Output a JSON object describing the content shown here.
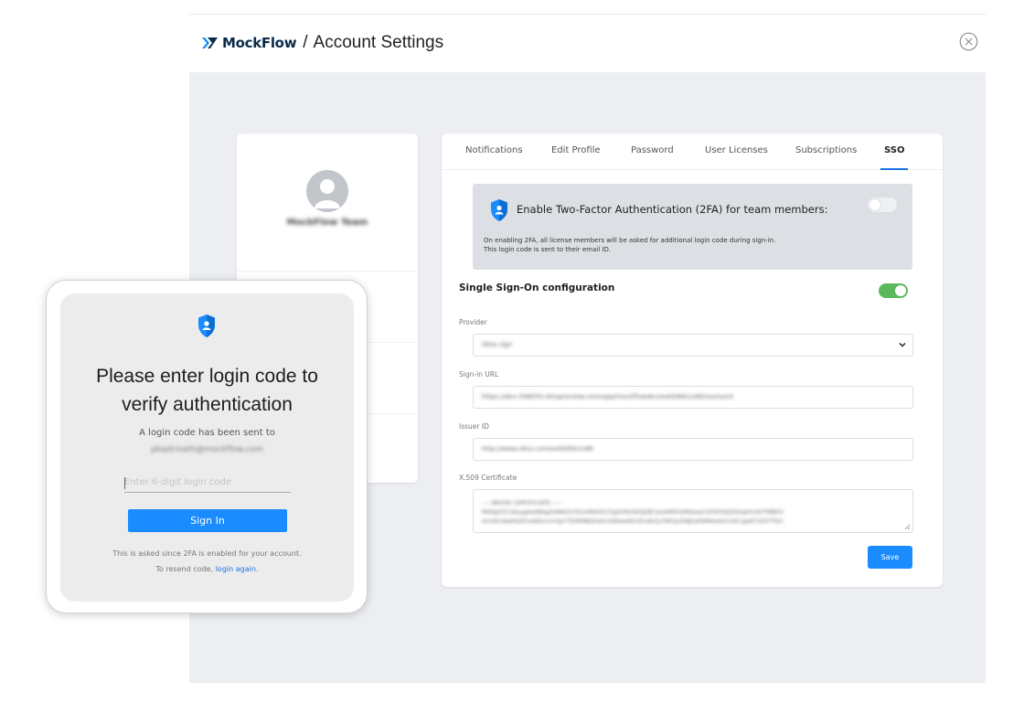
{
  "header": {
    "logo_text": "MockFlow",
    "separator": "/",
    "title": "Account Settings",
    "close_icon": "close-circle-icon"
  },
  "colors": {
    "brand_navy": "#0b2b4c",
    "accent_blue": "#1a8cff",
    "toggle_on": "#5cb85c",
    "panel_gray": "#eceef1"
  },
  "profile": {
    "avatar_icon": "user-avatar-icon",
    "name": "MockFlow Team"
  },
  "tabs": [
    {
      "label": "Notifications"
    },
    {
      "label": "Edit Profile"
    },
    {
      "label": "Password"
    },
    {
      "label": "User Licenses"
    },
    {
      "label": "Subscriptions"
    },
    {
      "label": "SSO",
      "active": true
    }
  ],
  "twofa": {
    "icon": "shield-user-icon",
    "title": "Enable Two-Factor Authentication (2FA) for team members:",
    "desc_line1": "On enabling 2FA, all license members will be asked for additional login code during sign-in.",
    "desc_line2": "This login code is sent to their email ID.",
    "enabled": false
  },
  "sso": {
    "heading": "Single Sign-On configuration",
    "enabled": true,
    "provider_label": "Provider",
    "provider_value": "Okta sign",
    "signin_url_label": "Sign-in URL",
    "signin_url_value": "https://dev-598050.oktapreview.com/app/mockflowdev/exkb9bk1s86/sso/saml",
    "issuer_label": "Issuer ID",
    "issuer_value": "http://www.okta.com/exkb9bk1s86",
    "cert_label": "X.509 Certificate",
    "cert_line1": "-----BEGIN CERTIFICATE-----",
    "cert_line2": "MIIDpDCCAoygAwIBAgIGAWZxYK2xMA0GCSqGSIb3DQEBCwUAMIGSMQswCQYDVQQGEwJVUzETMBEG",
    "cert_line3": "A1UECAwKQ2FsaWZvcm5pYTEWMBQGA1UEBwwNU2FuIEZyYW5jaXNjbzENMAsGA1UECgwET2t0YTEU",
    "save_label": "Save"
  },
  "login": {
    "icon": "shield-user-icon",
    "title_line1": "Please enter login code to",
    "title_line2": "verify authentication",
    "subtitle": "A login code has been sent to",
    "email": "pbadrinath@mockflow.com",
    "code_placeholder": "Enter 6-digit login code",
    "signin_label": "Sign In",
    "note": "This is asked since 2FA is enabled for your account.",
    "resend_prefix": "To resend code, ",
    "resend_link": "login again",
    "resend_suffix": "."
  }
}
